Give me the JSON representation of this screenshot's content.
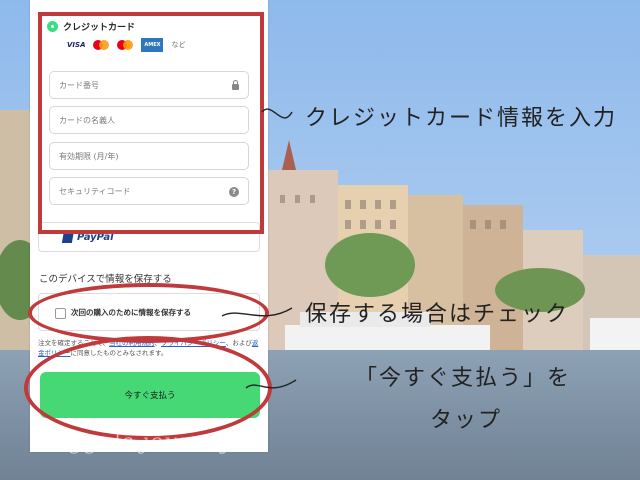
{
  "payment": {
    "method_label": "クレジットカード",
    "brands": [
      "VISA",
      "AMEX"
    ],
    "brands_more": "など",
    "fields": {
      "card_number": "カード番号",
      "card_name": "カードの名義人",
      "expiry": "有効期限 (月/年)",
      "security_code": "セキュリティコード"
    },
    "paypal_label": "PayPal"
  },
  "save": {
    "title": "このデバイスで情報を保存する",
    "checkbox_label": "次回の購入のために情報を保存する"
  },
  "terms": {
    "prefix": "注文を確定することで、",
    "link1": "当社の利用規約",
    "sep": "、",
    "link2": "プライバシーポリシー",
    "mid": "、および",
    "link3": "返金ポリシー",
    "suffix": "に同意したものとみなされます。"
  },
  "pay_button": "今すぐ支払う",
  "annotations": {
    "card": "クレジットカード情報を入力",
    "save": "保存する場合はチェック",
    "pay_line1": "「今すぐ支払う」を",
    "pay_line2": "タップ"
  },
  "watermark": "naggu's journey",
  "colors": {
    "accent_red": "#c0393b",
    "pay_green": "#46d874",
    "sky": "#8fb6e6"
  }
}
